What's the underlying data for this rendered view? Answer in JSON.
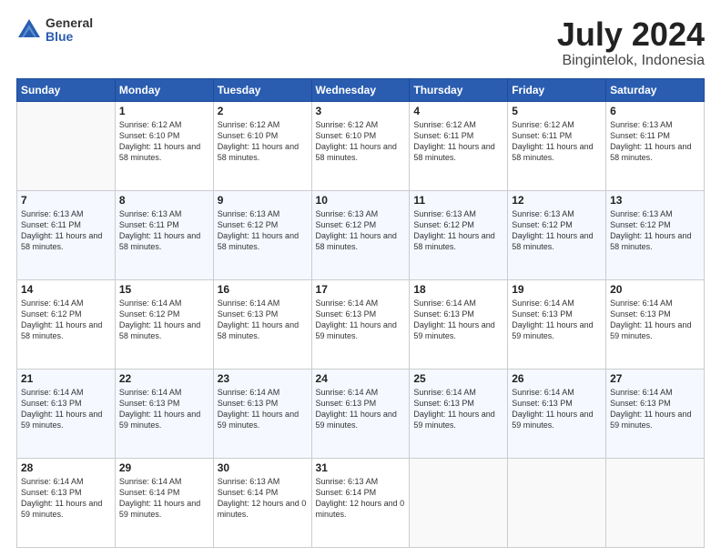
{
  "header": {
    "logo_general": "General",
    "logo_blue": "Blue",
    "title": "July 2024",
    "location": "Bingintelok, Indonesia"
  },
  "days": [
    "Sunday",
    "Monday",
    "Tuesday",
    "Wednesday",
    "Thursday",
    "Friday",
    "Saturday"
  ],
  "weeks": [
    [
      {
        "date": "",
        "sunrise": "",
        "sunset": "",
        "daylight": ""
      },
      {
        "date": "1",
        "sunrise": "Sunrise: 6:12 AM",
        "sunset": "Sunset: 6:10 PM",
        "daylight": "Daylight: 11 hours and 58 minutes."
      },
      {
        "date": "2",
        "sunrise": "Sunrise: 6:12 AM",
        "sunset": "Sunset: 6:10 PM",
        "daylight": "Daylight: 11 hours and 58 minutes."
      },
      {
        "date": "3",
        "sunrise": "Sunrise: 6:12 AM",
        "sunset": "Sunset: 6:10 PM",
        "daylight": "Daylight: 11 hours and 58 minutes."
      },
      {
        "date": "4",
        "sunrise": "Sunrise: 6:12 AM",
        "sunset": "Sunset: 6:11 PM",
        "daylight": "Daylight: 11 hours and 58 minutes."
      },
      {
        "date": "5",
        "sunrise": "Sunrise: 6:12 AM",
        "sunset": "Sunset: 6:11 PM",
        "daylight": "Daylight: 11 hours and 58 minutes."
      },
      {
        "date": "6",
        "sunrise": "Sunrise: 6:13 AM",
        "sunset": "Sunset: 6:11 PM",
        "daylight": "Daylight: 11 hours and 58 minutes."
      }
    ],
    [
      {
        "date": "7",
        "sunrise": "Sunrise: 6:13 AM",
        "sunset": "Sunset: 6:11 PM",
        "daylight": "Daylight: 11 hours and 58 minutes."
      },
      {
        "date": "8",
        "sunrise": "Sunrise: 6:13 AM",
        "sunset": "Sunset: 6:11 PM",
        "daylight": "Daylight: 11 hours and 58 minutes."
      },
      {
        "date": "9",
        "sunrise": "Sunrise: 6:13 AM",
        "sunset": "Sunset: 6:12 PM",
        "daylight": "Daylight: 11 hours and 58 minutes."
      },
      {
        "date": "10",
        "sunrise": "Sunrise: 6:13 AM",
        "sunset": "Sunset: 6:12 PM",
        "daylight": "Daylight: 11 hours and 58 minutes."
      },
      {
        "date": "11",
        "sunrise": "Sunrise: 6:13 AM",
        "sunset": "Sunset: 6:12 PM",
        "daylight": "Daylight: 11 hours and 58 minutes."
      },
      {
        "date": "12",
        "sunrise": "Sunrise: 6:13 AM",
        "sunset": "Sunset: 6:12 PM",
        "daylight": "Daylight: 11 hours and 58 minutes."
      },
      {
        "date": "13",
        "sunrise": "Sunrise: 6:13 AM",
        "sunset": "Sunset: 6:12 PM",
        "daylight": "Daylight: 11 hours and 58 minutes."
      }
    ],
    [
      {
        "date": "14",
        "sunrise": "Sunrise: 6:14 AM",
        "sunset": "Sunset: 6:12 PM",
        "daylight": "Daylight: 11 hours and 58 minutes."
      },
      {
        "date": "15",
        "sunrise": "Sunrise: 6:14 AM",
        "sunset": "Sunset: 6:12 PM",
        "daylight": "Daylight: 11 hours and 58 minutes."
      },
      {
        "date": "16",
        "sunrise": "Sunrise: 6:14 AM",
        "sunset": "Sunset: 6:13 PM",
        "daylight": "Daylight: 11 hours and 58 minutes."
      },
      {
        "date": "17",
        "sunrise": "Sunrise: 6:14 AM",
        "sunset": "Sunset: 6:13 PM",
        "daylight": "Daylight: 11 hours and 59 minutes."
      },
      {
        "date": "18",
        "sunrise": "Sunrise: 6:14 AM",
        "sunset": "Sunset: 6:13 PM",
        "daylight": "Daylight: 11 hours and 59 minutes."
      },
      {
        "date": "19",
        "sunrise": "Sunrise: 6:14 AM",
        "sunset": "Sunset: 6:13 PM",
        "daylight": "Daylight: 11 hours and 59 minutes."
      },
      {
        "date": "20",
        "sunrise": "Sunrise: 6:14 AM",
        "sunset": "Sunset: 6:13 PM",
        "daylight": "Daylight: 11 hours and 59 minutes."
      }
    ],
    [
      {
        "date": "21",
        "sunrise": "Sunrise: 6:14 AM",
        "sunset": "Sunset: 6:13 PM",
        "daylight": "Daylight: 11 hours and 59 minutes."
      },
      {
        "date": "22",
        "sunrise": "Sunrise: 6:14 AM",
        "sunset": "Sunset: 6:13 PM",
        "daylight": "Daylight: 11 hours and 59 minutes."
      },
      {
        "date": "23",
        "sunrise": "Sunrise: 6:14 AM",
        "sunset": "Sunset: 6:13 PM",
        "daylight": "Daylight: 11 hours and 59 minutes."
      },
      {
        "date": "24",
        "sunrise": "Sunrise: 6:14 AM",
        "sunset": "Sunset: 6:13 PM",
        "daylight": "Daylight: 11 hours and 59 minutes."
      },
      {
        "date": "25",
        "sunrise": "Sunrise: 6:14 AM",
        "sunset": "Sunset: 6:13 PM",
        "daylight": "Daylight: 11 hours and 59 minutes."
      },
      {
        "date": "26",
        "sunrise": "Sunrise: 6:14 AM",
        "sunset": "Sunset: 6:13 PM",
        "daylight": "Daylight: 11 hours and 59 minutes."
      },
      {
        "date": "27",
        "sunrise": "Sunrise: 6:14 AM",
        "sunset": "Sunset: 6:13 PM",
        "daylight": "Daylight: 11 hours and 59 minutes."
      }
    ],
    [
      {
        "date": "28",
        "sunrise": "Sunrise: 6:14 AM",
        "sunset": "Sunset: 6:13 PM",
        "daylight": "Daylight: 11 hours and 59 minutes."
      },
      {
        "date": "29",
        "sunrise": "Sunrise: 6:14 AM",
        "sunset": "Sunset: 6:14 PM",
        "daylight": "Daylight: 11 hours and 59 minutes."
      },
      {
        "date": "30",
        "sunrise": "Sunrise: 6:13 AM",
        "sunset": "Sunset: 6:14 PM",
        "daylight": "Daylight: 12 hours and 0 minutes."
      },
      {
        "date": "31",
        "sunrise": "Sunrise: 6:13 AM",
        "sunset": "Sunset: 6:14 PM",
        "daylight": "Daylight: 12 hours and 0 minutes."
      },
      {
        "date": "",
        "sunrise": "",
        "sunset": "",
        "daylight": ""
      },
      {
        "date": "",
        "sunrise": "",
        "sunset": "",
        "daylight": ""
      },
      {
        "date": "",
        "sunrise": "",
        "sunset": "",
        "daylight": ""
      }
    ]
  ]
}
